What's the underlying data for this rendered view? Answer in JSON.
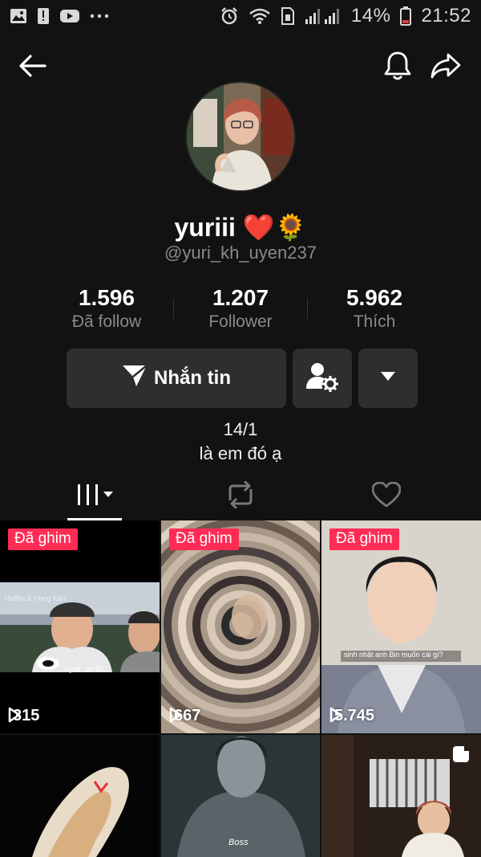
{
  "status_bar": {
    "battery": "14%",
    "time": "21:52",
    "icons": [
      "image-icon",
      "alert-icon",
      "youtube-icon",
      "more-dots-icon",
      "alarm-icon",
      "wifi-icon",
      "sim-icon",
      "signal-icon",
      "battery-icon"
    ]
  },
  "nav": {
    "back_icon": "arrow-left-icon",
    "bell_icon": "bell-icon",
    "share_icon": "share-icon"
  },
  "profile": {
    "display_name": "yuriii ❤️🌻",
    "username": "@yuri_kh_uyen237",
    "bio_line1": "14/1",
    "bio_line2": "là em đó ạ"
  },
  "stats": [
    {
      "value": "1.596",
      "label": "Đã follow"
    },
    {
      "value": "1.207",
      "label": "Follower"
    },
    {
      "value": "5.962",
      "label": "Thích"
    }
  ],
  "actions": {
    "message_label": "Nhắn tin"
  },
  "tabs": [
    "videos-grid-icon",
    "repost-icon",
    "heart-icon"
  ],
  "videos": [
    {
      "pinned": "Đã ghim",
      "views": "315",
      "caption_a": "HeRin & Hong Kan",
      "caption_b": "Hyuk: xin lỗi..."
    },
    {
      "pinned": "Đã ghim",
      "views": "667"
    },
    {
      "pinned": "Đã ghim",
      "views": "5.745",
      "caption_a": "sinh nhật anh Bin muốn cái gì?"
    },
    {},
    {
      "caption_a": "Boss"
    },
    {}
  ],
  "colors": {
    "background": "#121212",
    "button_bg": "#2e2e2e",
    "pinned_badge": "#fe2c55",
    "secondary_text": "#8a8a8a"
  }
}
